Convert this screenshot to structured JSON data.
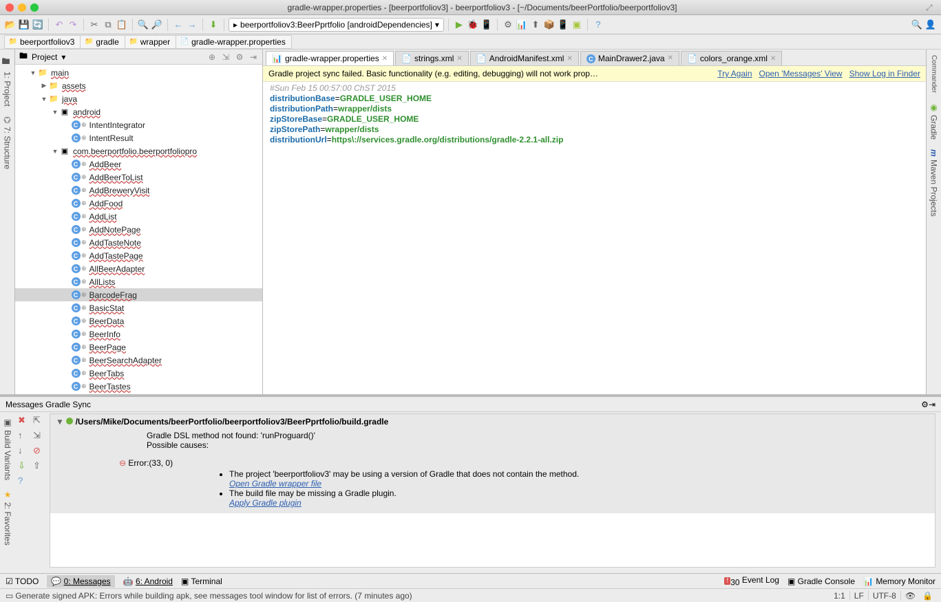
{
  "window": {
    "title": "gradle-wrapper.properties - [beerportfoliov3] - beerportfoliov3 - [~/Documents/beerPortfolio/beerportfoliov3]"
  },
  "runConfig": {
    "label": "beerportfoliov3:BeerPprtfolio [androidDependencies]"
  },
  "breadcrumbs": [
    "beerportfoliov3",
    "gradle",
    "wrapper",
    "gradle-wrapper.properties"
  ],
  "leftRail": [
    "1: Project",
    "7: Structure"
  ],
  "leftRail2": [
    "Build Variants",
    "2: Favorites"
  ],
  "rightRail": [
    "Commander",
    "Gradle",
    "Maven Projects"
  ],
  "projectPanel": {
    "title": "Project"
  },
  "tree": {
    "main": "main",
    "assets": "assets",
    "java": "java",
    "android": "android",
    "intent1": "IntentIntegrator",
    "intent2": "IntentResult",
    "pkg": "com.beerportfolio.beerportfoliopro",
    "classes": [
      "AddBeer",
      "AddBeerToList",
      "AddBreweryVisit",
      "AddFood",
      "AddList",
      "AddNotePage",
      "AddTasteNote",
      "AddTastePage",
      "AllBeerAdapter",
      "AllLists",
      "BarcodeFrag",
      "BasicStat",
      "BeerData",
      "BeerInfo",
      "BeerPage",
      "BeerSearchAdapter",
      "BeerTabs",
      "BeerTastes"
    ]
  },
  "tabs": [
    {
      "label": "gradle-wrapper.properties",
      "icon": "props",
      "active": true
    },
    {
      "label": "strings.xml",
      "icon": "xml"
    },
    {
      "label": "AndroidManifest.xml",
      "icon": "xml"
    },
    {
      "label": "MainDrawer2.java",
      "icon": "class"
    },
    {
      "label": "colors_orange.xml",
      "icon": "xml"
    }
  ],
  "notice": {
    "text": "Gradle project sync failed. Basic functionality (e.g. editing, debugging) will not work prop…",
    "link1": "Try Again",
    "link2": "Open 'Messages' View",
    "link3": "Show Log in Finder"
  },
  "editor": {
    "comment": "#Sun Feb 15 00:57:00 ChST 2015",
    "lines": [
      {
        "k": "distributionBase",
        "v": "GRADLE_USER_HOME"
      },
      {
        "k": "distributionPath",
        "v": "wrapper/dists"
      },
      {
        "k": "zipStoreBase",
        "v": "GRADLE_USER_HOME"
      },
      {
        "k": "zipStorePath",
        "v": "wrapper/dists"
      },
      {
        "k": "distributionUrl",
        "v": "https\\://services.gradle.org/distributions/gradle-2.2.1-all.zip"
      }
    ]
  },
  "messages": {
    "title": "Messages Gradle Sync",
    "path": "/Users/Mike/Documents/beerPortfolio/beerportfoliov3/BeerPprtfolio/build.gradle",
    "line1": "Gradle DSL method not found: 'runProguard()'",
    "line2": "Possible causes:",
    "errLabel": "Error:(33, 0)",
    "bullet1": "The project 'beerportfoliov3' may be using a version of Gradle that does not contain the method.",
    "link1": "Open Gradle wrapper file",
    "bullet2": "The build file may be missing a Gradle plugin.",
    "link2": "Apply Gradle plugin"
  },
  "bottomBar": {
    "todo": "TODO",
    "messages": "0: Messages",
    "android": "6: Android",
    "terminal": "Terminal",
    "eventLog": "Event Log",
    "eventCount": "30",
    "gradleConsole": "Gradle Console",
    "memoryMonitor": "Memory Monitor"
  },
  "statusBar": {
    "text": "Generate signed APK: Errors while building apk, see messages tool window for list of errors. (7 minutes ago)",
    "pos": "1:1",
    "lf": "LF",
    "enc": "UTF-8"
  }
}
